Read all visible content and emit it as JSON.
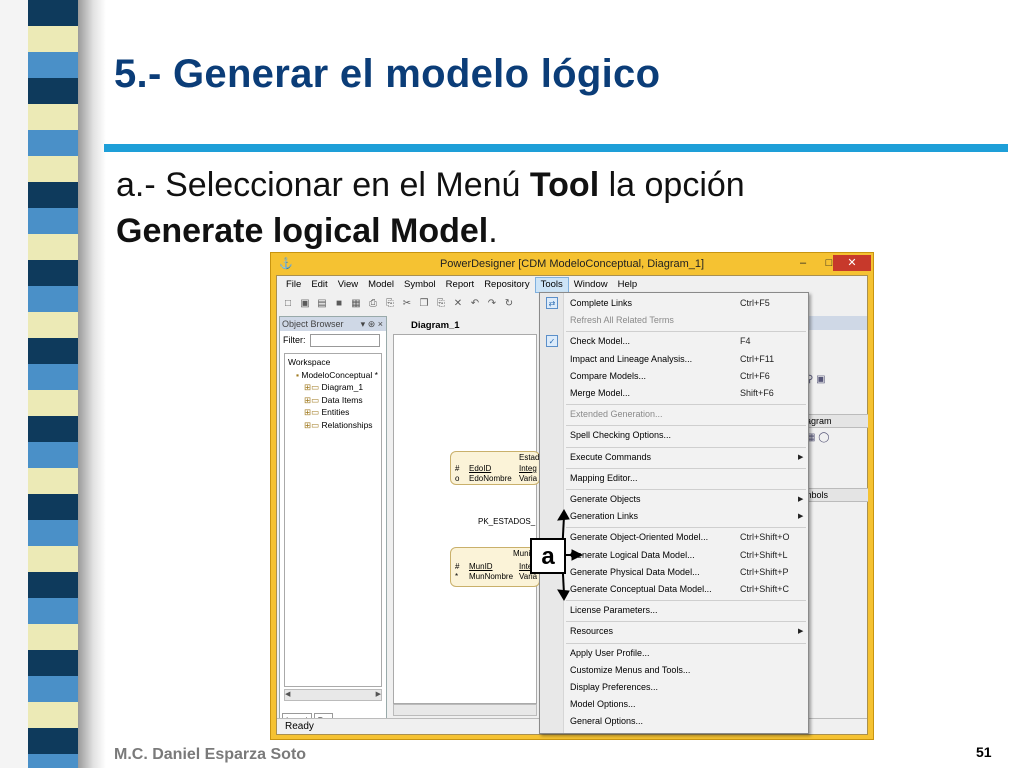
{
  "slide": {
    "title": "5.- Generar el modelo lógico",
    "instruction": {
      "prefix": "a.- Seleccionar en el Menú ",
      "bold_menu": "Tool",
      "middle": " la opción ",
      "bold_option": "Generate logical Model",
      "suffix": "."
    },
    "author": "M.C. Daniel Esparza Soto",
    "page_number": "51",
    "callout_label": "a"
  },
  "colors": {
    "title": "#0b3d78",
    "rule": "#1e9fd8",
    "window_frame": "#f5c232",
    "stripe_dark": "#0e3a5c",
    "stripe_light": "#eceab6",
    "stripe_blue": "#4a90c8"
  },
  "window": {
    "title": "PowerDesigner [CDM ModeloConceptual, Diagram_1]",
    "controls": {
      "minimize": "‒",
      "maximize": "□",
      "close": "✕"
    },
    "menubar": [
      "File",
      "Edit",
      "View",
      "Model",
      "Symbol",
      "Report",
      "Repository",
      "Tools",
      "Window",
      "Help"
    ],
    "active_menu": "Tools",
    "toolbar_icons": [
      "new-icon",
      "open-icon",
      "open-folder-icon",
      "save-icon",
      "save-all-icon",
      "print-icon",
      "print-preview-icon",
      "cut-icon",
      "copy-icon",
      "paste-icon",
      "delete-icon",
      "undo-icon",
      "redo-icon",
      "refresh-icon"
    ],
    "object_browser": {
      "header": "Object Browser",
      "filter_label": "Filter:",
      "tree": [
        {
          "label": "Workspace",
          "level": 0
        },
        {
          "label": "ModeloConceptual *",
          "level": 1
        },
        {
          "label": "Diagram_1",
          "level": 2
        },
        {
          "label": "Data Items",
          "level": 2
        },
        {
          "label": "Entities",
          "level": 2
        },
        {
          "label": "Relationships",
          "level": 2
        }
      ],
      "tabs": [
        "Local",
        "Re"
      ]
    },
    "diagram": {
      "tab_label": "Diagram_1",
      "entities": [
        {
          "name": "Estad",
          "rows": [
            [
              "#",
              "EdoID",
              "Integ"
            ],
            [
              "o",
              "EdoNombre",
              "Varia"
            ]
          ]
        },
        {
          "name": "Munic",
          "rows": [
            [
              "#",
              "MunID",
              "Inte"
            ],
            [
              "*",
              "MunNombre",
              "Varia"
            ]
          ]
        }
      ],
      "relationship_label": "PK_ESTADOS_"
    },
    "status_text": "Ready",
    "right_panel": {
      "section_diagram": "iagram",
      "section_symbols": "mbols"
    },
    "tools_menu": [
      {
        "label": "Complete Links",
        "shortcut": "Ctrl+F5",
        "icon": "complete-links-icon",
        "disabled": false,
        "submenu": false
      },
      {
        "label": "Refresh All Related Terms",
        "shortcut": "",
        "icon": "",
        "disabled": true,
        "submenu": false
      },
      {
        "label": "Check Model...",
        "shortcut": "F4",
        "icon": "check-model-icon",
        "disabled": false,
        "submenu": false
      },
      {
        "label": "Impact and Lineage Analysis...",
        "shortcut": "Ctrl+F11",
        "icon": "",
        "disabled": false,
        "submenu": false
      },
      {
        "label": "Compare Models...",
        "shortcut": "Ctrl+F6",
        "icon": "",
        "disabled": false,
        "submenu": false
      },
      {
        "label": "Merge Model...",
        "shortcut": "Shift+F6",
        "icon": "",
        "disabled": false,
        "submenu": false
      },
      {
        "label": "Extended Generation...",
        "shortcut": "",
        "icon": "",
        "disabled": true,
        "submenu": false
      },
      {
        "label": "Spell Checking Options...",
        "shortcut": "",
        "icon": "",
        "disabled": false,
        "submenu": false
      },
      {
        "label": "Execute Commands",
        "shortcut": "",
        "icon": "",
        "disabled": false,
        "submenu": true
      },
      {
        "label": "Mapping Editor...",
        "shortcut": "",
        "icon": "",
        "disabled": false,
        "submenu": false
      },
      {
        "label": "Generate Objects",
        "shortcut": "",
        "icon": "",
        "disabled": false,
        "submenu": true
      },
      {
        "label": "Generation Links",
        "shortcut": "",
        "icon": "",
        "disabled": false,
        "submenu": true
      },
      {
        "label": "Generate Object-Oriented Model...",
        "shortcut": "Ctrl+Shift+O",
        "icon": "",
        "disabled": false,
        "submenu": false
      },
      {
        "label": "Generate Logical Data Model...",
        "shortcut": "Ctrl+Shift+L",
        "icon": "",
        "disabled": false,
        "submenu": false
      },
      {
        "label": "Generate Physical Data Model...",
        "shortcut": "Ctrl+Shift+P",
        "icon": "",
        "disabled": false,
        "submenu": false
      },
      {
        "label": "Generate Conceptual Data Model...",
        "shortcut": "Ctrl+Shift+C",
        "icon": "",
        "disabled": false,
        "submenu": false
      },
      {
        "label": "License Parameters...",
        "shortcut": "",
        "icon": "",
        "disabled": false,
        "submenu": false
      },
      {
        "label": "Resources",
        "shortcut": "",
        "icon": "",
        "disabled": false,
        "submenu": true
      },
      {
        "label": "Apply User Profile...",
        "shortcut": "",
        "icon": "",
        "disabled": false,
        "submenu": false
      },
      {
        "label": "Customize Menus and Tools...",
        "shortcut": "",
        "icon": "",
        "disabled": false,
        "submenu": false
      },
      {
        "label": "Display Preferences...",
        "shortcut": "",
        "icon": "",
        "disabled": false,
        "submenu": false
      },
      {
        "label": "Model Options...",
        "shortcut": "",
        "icon": "",
        "disabled": false,
        "submenu": false
      },
      {
        "label": "General Options...",
        "shortcut": "",
        "icon": "",
        "disabled": false,
        "submenu": false
      }
    ]
  }
}
